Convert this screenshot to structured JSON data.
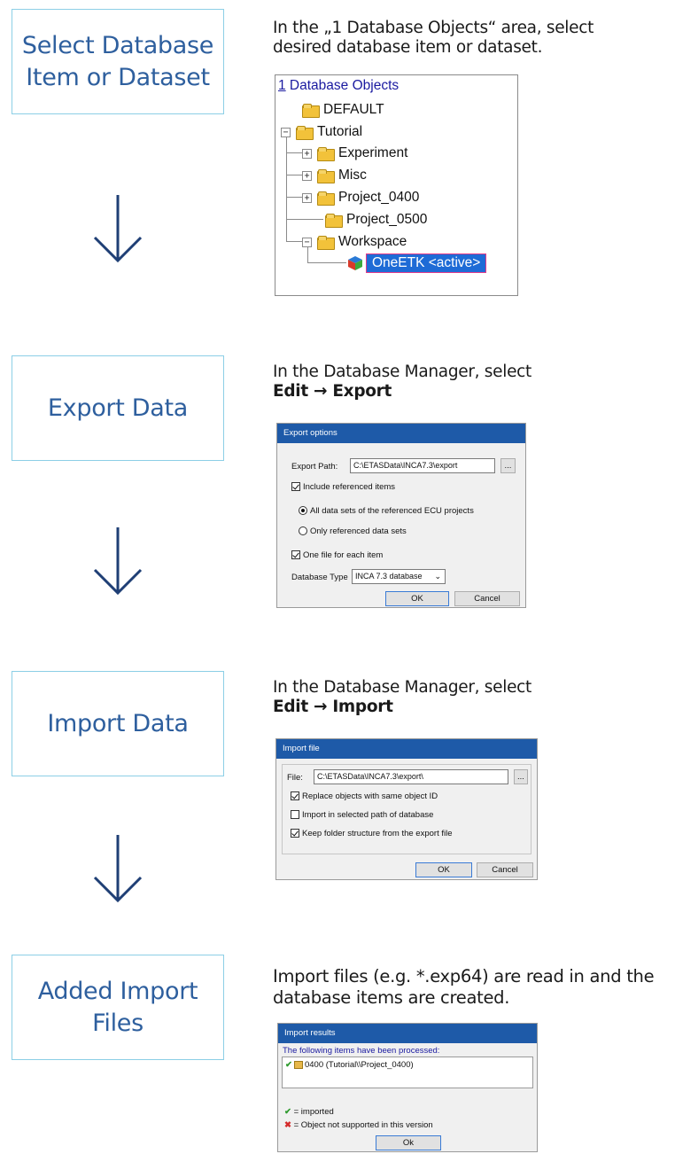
{
  "steps": [
    {
      "line1": "Select Database",
      "line2": "Item or Dataset"
    },
    {
      "line1": "Export Data"
    },
    {
      "line1": "Import Data"
    },
    {
      "line1": "Added Import",
      "line2": "Files"
    }
  ],
  "descriptions": {
    "step1": {
      "line1": "In the „1 Database Objects“ area, select",
      "line2": "desired database item or dataset."
    },
    "step2": {
      "line1": "In the Database Manager, select",
      "bold": "Edit → Export"
    },
    "step3": {
      "line1": "In the Database Manager, select",
      "bold": "Edit → Import"
    },
    "step4": {
      "line1": "Import files (e.g. *.exp64) are read in and the",
      "line2": "database items are created."
    }
  },
  "tree": {
    "title_num": "1",
    "title_rest": " Database Objects",
    "items": [
      "DEFAULT",
      "Tutorial",
      "Experiment",
      "Misc",
      "Project_0400",
      "Project_0500",
      "Workspace",
      "OneETK <active>"
    ]
  },
  "export_dialog": {
    "title": "Export options",
    "path_label": "Export Path:",
    "path_value": "C:\\ETASData\\INCA7.3\\export",
    "browse": "...",
    "include_refs": "Include referenced items",
    "radio_all": "All data sets of the referenced ECU projects",
    "radio_only": "Only referenced data sets",
    "one_file": "One file for each item",
    "db_type_label": "Database Type",
    "db_type_value": "INCA 7.3 database",
    "ok": "OK",
    "cancel": "Cancel"
  },
  "import_dialog": {
    "title": "Import file",
    "file_label": "File:",
    "file_value": "C:\\ETASData\\INCA7.3\\export\\",
    "browse": "...",
    "replace": "Replace objects with same object ID",
    "import_selected": "Import in selected path of database",
    "keep_structure": "Keep folder structure from the export file",
    "ok": "OK",
    "cancel": "Cancel"
  },
  "results_dialog": {
    "title": "Import results",
    "header": "The following items have been processed:",
    "item": "0400 (Tutorial\\\\Project_0400)",
    "legend_imported": "= imported",
    "legend_unsupported": "= Object not supported in this version",
    "ok": "Ok"
  },
  "colors": {
    "step_text": "#2e5f9e",
    "step_border": "#8ccfe6",
    "arrow": "#1f3f75",
    "dialog_title_bar": "#1e5aa8",
    "active_highlight": "#1e6bd6"
  }
}
